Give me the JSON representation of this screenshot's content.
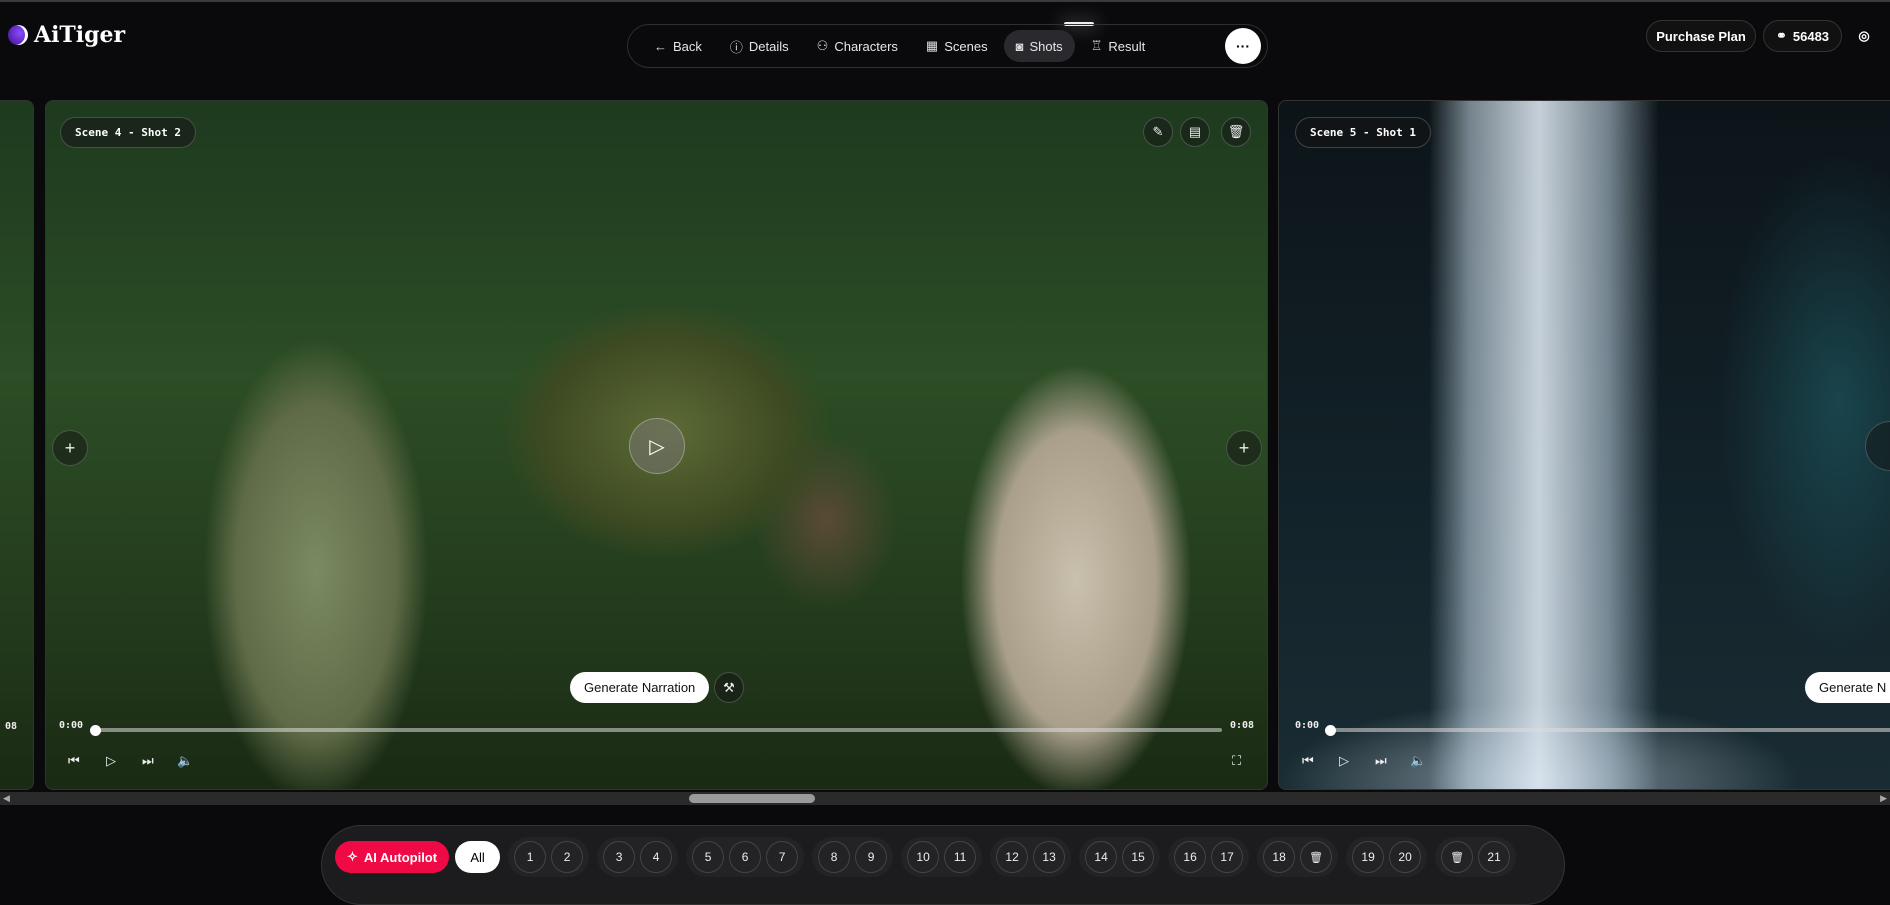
{
  "app": {
    "name": "AiTiger"
  },
  "nav": {
    "items": [
      {
        "label": "Back",
        "icon": "arrow-left-icon",
        "glyph": "←"
      },
      {
        "label": "Details",
        "icon": "info-icon",
        "glyph": "ⓘ"
      },
      {
        "label": "Characters",
        "icon": "user-icon",
        "glyph": "⚇"
      },
      {
        "label": "Scenes",
        "icon": "film-icon",
        "glyph": "▦"
      },
      {
        "label": "Shots",
        "icon": "camera-icon",
        "glyph": "◙",
        "active": true
      },
      {
        "label": "Result",
        "icon": "popcorn-icon",
        "glyph": "♖"
      }
    ],
    "more": "···"
  },
  "header": {
    "purchase_label": "Purchase Plan",
    "credits": "56483"
  },
  "cards": [
    {
      "label": "Scene 4 - Shot 2",
      "time_start": "0:00",
      "time_end": "0:08",
      "generate_label": "Generate Narration",
      "progress": 0
    },
    {
      "label": "Scene 5 - Shot 1",
      "time_start": "0:00",
      "generate_label": "Generate N",
      "progress": 0
    }
  ],
  "prev_card": {
    "time_end": "08"
  },
  "bottom": {
    "autopilot_label": "AI Autopilot",
    "all_label": "All",
    "groups": [
      [
        "1",
        "2"
      ],
      [
        "3",
        "4"
      ],
      [
        "5",
        "6",
        "7"
      ],
      [
        "8",
        "9"
      ],
      [
        "10",
        "11"
      ],
      [
        "12",
        "13"
      ],
      [
        "14",
        "15"
      ],
      [
        "16",
        "17"
      ],
      [
        "18",
        "trash"
      ],
      [
        "19",
        "20"
      ],
      [
        "trash",
        "21"
      ]
    ]
  },
  "colors": {
    "accent": "#ef0a45",
    "background": "#0a0a0c"
  }
}
